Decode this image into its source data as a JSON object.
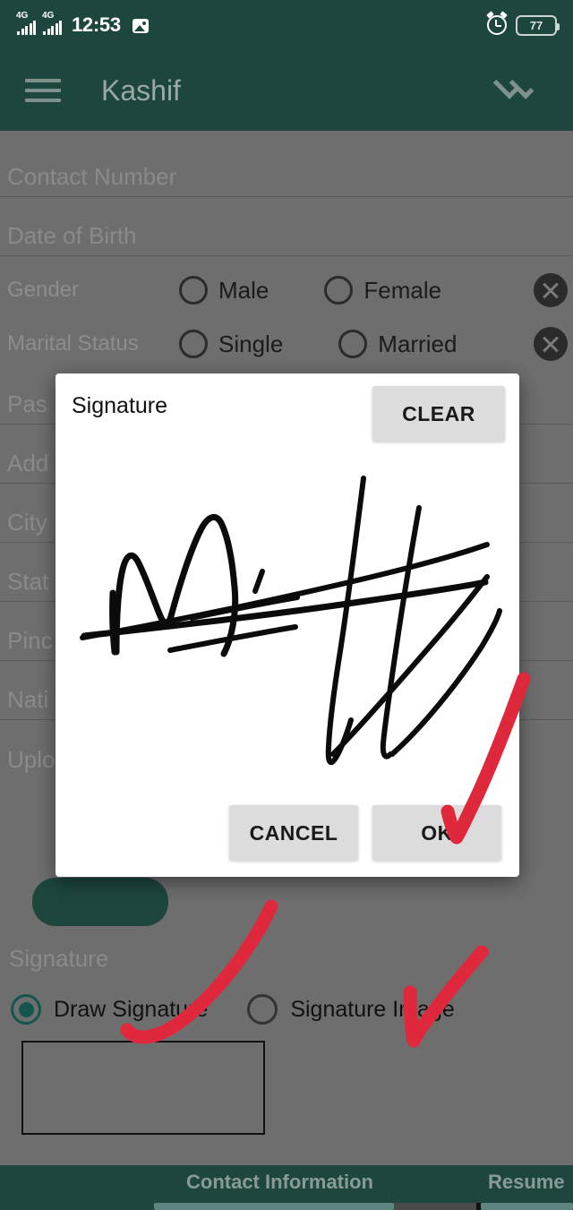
{
  "status_bar": {
    "network_1": "4G",
    "network_2": "4G",
    "time": "12:53",
    "photo_icon": "photo-icon",
    "alarm_icon": "alarm-icon",
    "battery_level": "77"
  },
  "app_bar": {
    "menu_icon": "hamburger-menu-icon",
    "title": "Kashif",
    "action_icon": "double-check-icon"
  },
  "form": {
    "fields": [
      {
        "label": "Contact Number",
        "value": ""
      },
      {
        "label": "Date of Birth",
        "value": ""
      },
      {
        "label": "Pas",
        "value": ""
      },
      {
        "label": "Add",
        "value": ""
      },
      {
        "label": "City",
        "value": ""
      },
      {
        "label": "Stat",
        "value": ""
      },
      {
        "label": "Pinc",
        "value": ""
      },
      {
        "label": "Nati",
        "value": ""
      },
      {
        "label": "Uplo",
        "value": ""
      }
    ],
    "radio_groups": [
      {
        "label": "Gender",
        "options": [
          {
            "text": "Male",
            "selected": false
          },
          {
            "text": "Female",
            "selected": false
          }
        ],
        "clear_icon": "clear-circle-x-icon"
      },
      {
        "label": "Marital Status",
        "options": [
          {
            "text": "Single",
            "selected": false
          },
          {
            "text": "Married",
            "selected": false
          }
        ],
        "clear_icon": "clear-circle-x-icon"
      }
    ]
  },
  "signature_section": {
    "heading": "Signature",
    "options": [
      {
        "text": "Draw Signature",
        "selected": true
      },
      {
        "text": "Signature Image",
        "selected": false
      }
    ]
  },
  "dialog": {
    "title": "Signature",
    "clear_label": "CLEAR",
    "cancel_label": "CANCEL",
    "ok_label": "OK"
  },
  "tab_bar": {
    "tabs": [
      {
        "label": "Contact Information",
        "active": false
      },
      {
        "label": "Resume",
        "active": false
      }
    ]
  },
  "colors": {
    "app_bar": "#1d463f",
    "dimmed_background": "#6e6e6e",
    "dialog_background": "#ffffff",
    "button_grey": "#dcdcdc",
    "accent_teal": "#14564e",
    "annotation_red": "#e0283c"
  },
  "annotations": [
    {
      "name": "arrow-to-ok-button",
      "type": "red-checkmark"
    },
    {
      "name": "arrow-to-draw-signature",
      "type": "red-stroke"
    },
    {
      "name": "arrow-to-signature-image",
      "type": "red-checkmark"
    }
  ]
}
